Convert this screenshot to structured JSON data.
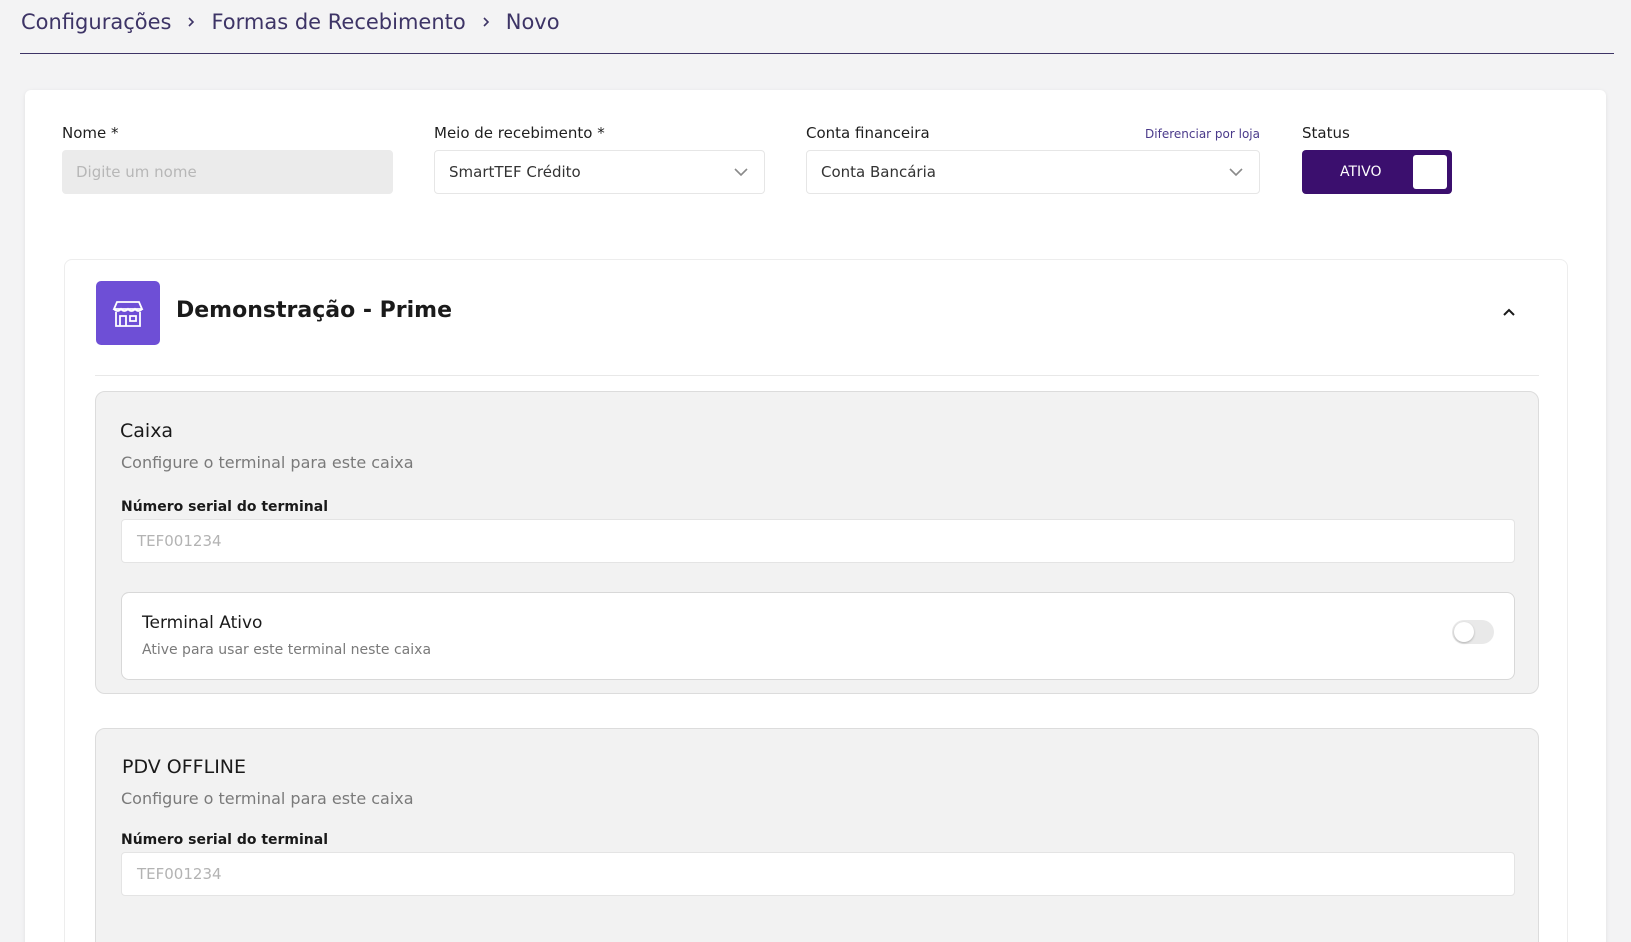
{
  "breadcrumb": {
    "items": [
      "Configurações",
      "Formas de Recebimento",
      "Novo"
    ]
  },
  "form": {
    "nome": {
      "label": "Nome *",
      "placeholder": "Digite um nome",
      "value": ""
    },
    "meio": {
      "label": "Meio de recebimento *",
      "value": "SmartTEF Crédito"
    },
    "conta": {
      "label": "Conta financeira",
      "link": "Diferenciar por loja",
      "value": "Conta Bancária"
    },
    "status": {
      "label": "Status",
      "value": "ATIVO"
    }
  },
  "store": {
    "title": "Demonstração - Prime",
    "registers": [
      {
        "name": "Caixa",
        "subtitle": "Configure o terminal para este caixa",
        "serial_label": "Número serial do terminal",
        "serial_placeholder": "TEF001234",
        "terminal_title": "Terminal Ativo",
        "terminal_sub": "Ative para usar este terminal neste caixa"
      },
      {
        "name": "PDV OFFLINE",
        "subtitle": "Configure o terminal para este caixa",
        "serial_label": "Número serial do terminal",
        "serial_placeholder": "TEF001234"
      }
    ]
  },
  "colors": {
    "accent": "#3b0f6e",
    "store_icon_bg": "#6e4fd6",
    "breadcrumb_text": "#3d3466"
  },
  "icons": {
    "breadcrumb_separator": "chevron-right-icon",
    "select": "chevron-down-icon",
    "store": "storefront-icon",
    "collapse": "chevron-up-icon"
  }
}
